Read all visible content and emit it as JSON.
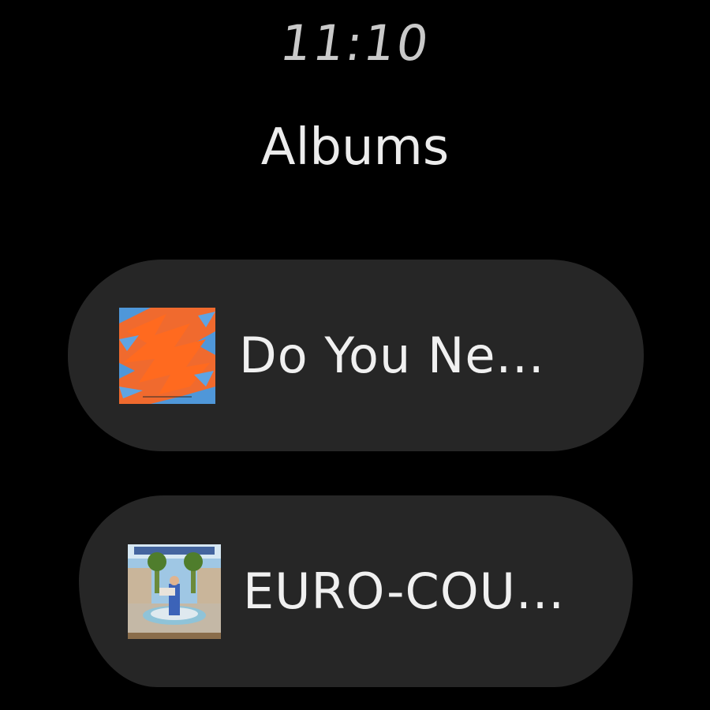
{
  "status": {
    "time": "11:10"
  },
  "page": {
    "title": "Albums"
  },
  "albums": [
    {
      "title": "Do You Ne...",
      "art": "orange-blue-abstract-album-art"
    },
    {
      "title": "EURO-COU...",
      "art": "euro-country-album-art"
    }
  ],
  "colors": {
    "background": "#000000",
    "chip": "#262626",
    "text": "#f0f0f0",
    "clock": "#c9c9c9"
  }
}
